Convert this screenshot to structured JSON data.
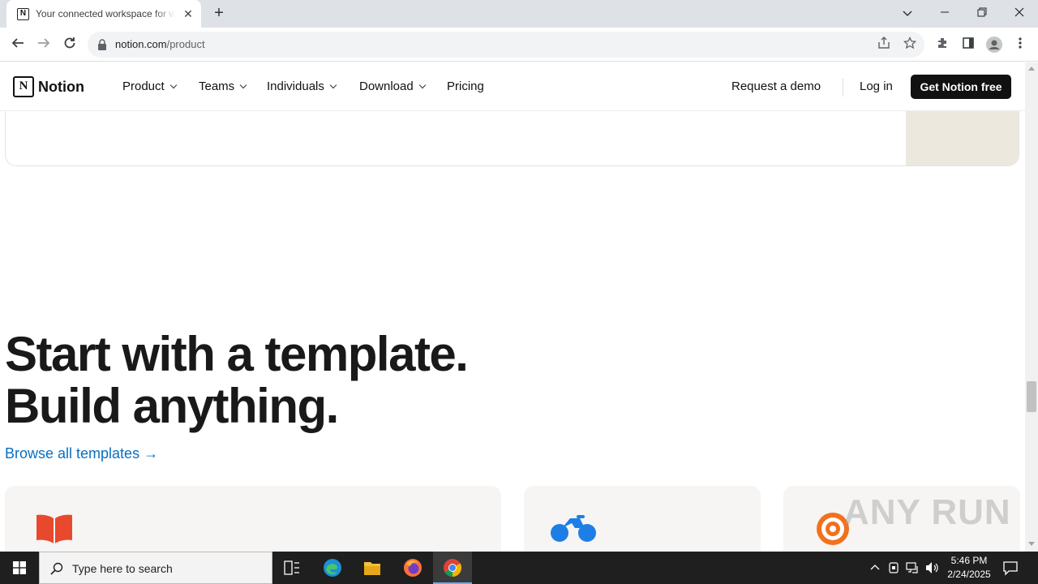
{
  "browser": {
    "tab_title": "Your connected workspace for wiki, docs & projects | Notion",
    "tab_favicon": "notion-icon",
    "url_host": "notion.com",
    "url_path": "/product"
  },
  "nav": {
    "brand": "Notion",
    "menu": [
      {
        "label": "Product",
        "has_dropdown": true
      },
      {
        "label": "Teams",
        "has_dropdown": true
      },
      {
        "label": "Individuals",
        "has_dropdown": true
      },
      {
        "label": "Download",
        "has_dropdown": true
      },
      {
        "label": "Pricing",
        "has_dropdown": false
      }
    ],
    "request_demo": "Request a demo",
    "login": "Log in",
    "cta": "Get Notion free"
  },
  "hero": {
    "line1": "Start with a template.",
    "line2": "Build anything.",
    "browse_link": "Browse all templates →"
  },
  "template_cards": [
    {
      "icon": "open-book-icon",
      "icon_color": "#e8492c"
    },
    {
      "icon": "motorcycle-icon",
      "icon_color": "#1d7fe6"
    },
    {
      "icon": "target-icon",
      "icon_color": "#f2711c"
    }
  ],
  "watermark": "ANY RUN",
  "taskbar": {
    "search_placeholder": "Type here to search",
    "time": "5:46 PM",
    "date": "2/24/2025"
  }
}
